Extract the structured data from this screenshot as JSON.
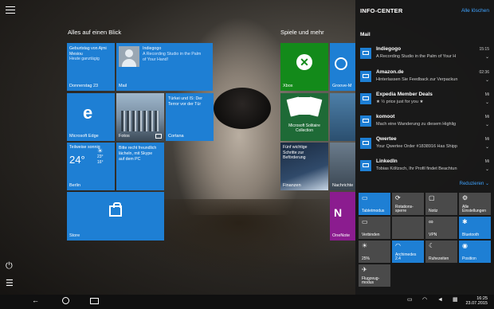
{
  "start": {
    "group1_title": "Alles auf einen Blick",
    "group2_title": "Spiele und mehr",
    "calendar": {
      "line1": "Geburtstag von Ajmi",
      "line2": "Mesiou",
      "line3": "Heute ganztägig",
      "label": "Donnerstag 23"
    },
    "mail": {
      "sender": "Indiegogo",
      "line1": "A Recording Studio in the Palm",
      "line2": "of Your Hand!",
      "label": "Mail"
    },
    "edge_label": "Microsoft Edge",
    "photos_label": "Fotos",
    "cortana": {
      "line1": "Türkei und IS: Der",
      "line2": "Terror vor der Tür",
      "label": "Cortana"
    },
    "weather": {
      "cond": "Teilweise sonnig",
      "temp": "24°",
      "hi": "23°",
      "lo": "16°",
      "label": "Berlin"
    },
    "phone": {
      "line1": "Bitte recht freundlich",
      "line2": "lächeln, mit Skype",
      "line3": "auf dem PC"
    },
    "store_label": "Store",
    "xbox_label": "Xbox",
    "groove_label": "Groove-M",
    "solitaire_label": "Microsoft Solitaire Collection",
    "finance": {
      "line1": "Fünf wichtige",
      "line2": "Schritte zur",
      "line3": "Beförderung",
      "label": "Finanzen"
    },
    "news_label": "Nachrichte",
    "onenote_label": "OneNote"
  },
  "action_center": {
    "title": "INFO-CENTER",
    "clear_all": "Alle löschen",
    "section": "Mail",
    "collapse": "Reduzieren",
    "notifications": [
      {
        "title": "Indiegogo",
        "body": "A Recording Studio in the Palm of Your H",
        "time": "15:15"
      },
      {
        "title": "Amazon.de",
        "body": "Hinterlassen Sie Feedback zur Verpackun",
        "time": "02:36"
      },
      {
        "title": "Expedia Member Deals",
        "body": "★ ½ price just for you ★",
        "time": "Mi"
      },
      {
        "title": "komoot",
        "body": "Mach eine Wanderung zu diesem Highlig",
        "time": "Mi"
      },
      {
        "title": "Qwertee",
        "body": "Your Qwertee Order #1838916 Has Shipp",
        "time": "Mi"
      },
      {
        "title": "LinkedIn",
        "body": "Tobias Költzsch, Ihr Profil findet Beachtun",
        "time": "Mi"
      }
    ],
    "quick_actions": [
      {
        "label": "Tabletmodus",
        "glyph": "▭",
        "state": "on"
      },
      {
        "label": "Rotations-sperre",
        "glyph": "⟳",
        "state": "off"
      },
      {
        "label": "Notiz",
        "glyph": "▢",
        "state": "off"
      },
      {
        "label": "Alle Einstellungen",
        "glyph": "⚙",
        "state": "off"
      },
      {
        "label": "Verbinden",
        "glyph": "▭",
        "state": "off"
      },
      {
        "label": "",
        "glyph": "",
        "state": "off"
      },
      {
        "label": "VPN",
        "glyph": "∞",
        "state": "off"
      },
      {
        "label": "Bluetooth",
        "glyph": "✱",
        "state": "on"
      },
      {
        "label": "25%",
        "glyph": "☀",
        "state": "off"
      },
      {
        "label": "Archimedes 2.4",
        "glyph": "◠",
        "state": "on"
      },
      {
        "label": "Ruhezeiten",
        "glyph": "☾",
        "state": "off"
      },
      {
        "label": "Position",
        "glyph": "◉",
        "state": "on"
      },
      {
        "label": "Flugzeug-modus",
        "glyph": "✈",
        "state": "off"
      }
    ]
  },
  "taskbar": {
    "time": "16:25",
    "date": "23.07.2015"
  }
}
